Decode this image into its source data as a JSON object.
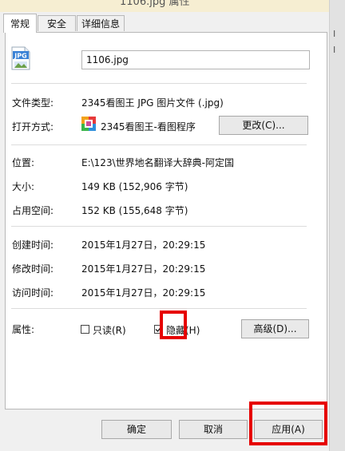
{
  "window": {
    "title": "1106.jpg 属性"
  },
  "tabs": [
    {
      "label": "常规"
    },
    {
      "label": "安全"
    },
    {
      "label": "详细信息"
    }
  ],
  "file": {
    "name": "1106.jpg",
    "icon_badge": "JPG"
  },
  "props": {
    "type_label": "文件类型:",
    "type_value": "2345看图王 JPG 图片文件 (.jpg)",
    "open_label": "打开方式:",
    "open_value": "2345看图王-看图程序",
    "change_button": "更改(C)...",
    "location_label": "位置:",
    "location_value": "E:\\123\\世界地名翻译大辞典-阿定国",
    "size_label": "大小:",
    "size_value": "149 KB (152,906 字节)",
    "disk_label": "占用空间:",
    "disk_value": "152 KB (155,648 字节)",
    "created_label": "创建时间:",
    "created_value": "2015年1月27日，20:29:15",
    "modified_label": "修改时间:",
    "modified_value": "2015年1月27日，20:29:15",
    "accessed_label": "访问时间:",
    "accessed_value": "2015年1月27日，20:29:15",
    "attr_label": "属性:",
    "readonly_label": "只读(R)",
    "hidden_label": "隐藏(H)",
    "advanced_button": "高级(D)..."
  },
  "footer": {
    "ok": "确定",
    "cancel": "取消",
    "apply": "应用(A)"
  },
  "colors": {
    "highlight": "#e60000"
  }
}
